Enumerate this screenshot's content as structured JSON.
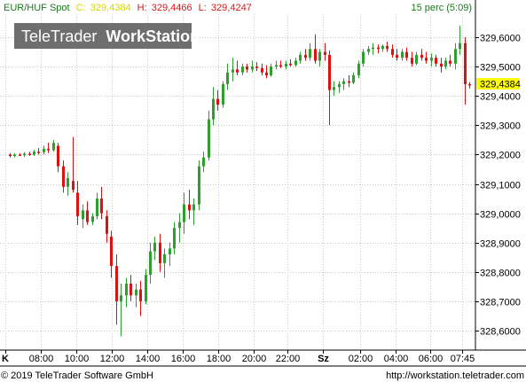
{
  "header": {
    "symbol": "EUR/HUF Spot",
    "close_label": "C:",
    "close_value": "329,4384",
    "high_label": "H:",
    "high_value": "329,4466",
    "low_label": "L:",
    "low_value": "329,4247",
    "interval": "15 perc (5:09)"
  },
  "watermark": {
    "text_normal": "TeleTrader",
    "text_bold": "WorkStation"
  },
  "last_price_tag": "329,4384",
  "footer": {
    "copyright": "© 2019 TeleTrader Software GmbH",
    "url": "http://workstation.teletrader.com"
  },
  "colors": {
    "up": "#2e9e2e",
    "down": "#dd1111",
    "grid": "#c8c8c8",
    "header_green": "#1a7a1a",
    "header_red": "#d81818",
    "close_yellow": "#d6d600",
    "tag_bg": "#ffff00",
    "watermark_bg": "#6e6e6e"
  },
  "chart_data": {
    "type": "candlestick",
    "title": "EUR/HUF Spot",
    "ylim": [
      328.54,
      329.66
    ],
    "y_ticks": [
      328.6,
      328.7,
      328.8,
      328.9,
      329.0,
      329.1,
      329.2,
      329.3,
      329.4,
      329.5,
      329.6
    ],
    "y_tick_labels": [
      "328,6000",
      "328,7000",
      "328,8000",
      "328,9000",
      "329,0000",
      "329,1000",
      "329,2000",
      "329,3000",
      "329,4000",
      "329,5000",
      "329,6000"
    ],
    "x_tick_labels": [
      "K",
      "08:00",
      "10:00",
      "12:00",
      "14:00",
      "16:00",
      "18:00",
      "20:00",
      "22:00",
      "Sz",
      "02:00",
      "04:00",
      "06:00",
      "07:45"
    ],
    "x_tick_bold": [
      true,
      false,
      false,
      false,
      false,
      false,
      false,
      false,
      false,
      true,
      false,
      false,
      false,
      false
    ],
    "grid": true,
    "candles": [
      {
        "o": 329.2,
        "h": 329.205,
        "l": 329.19,
        "c": 329.195
      },
      {
        "o": 329.195,
        "h": 329.205,
        "l": 329.19,
        "c": 329.2
      },
      {
        "o": 329.2,
        "h": 329.205,
        "l": 329.195,
        "c": 329.198
      },
      {
        "o": 329.198,
        "h": 329.208,
        "l": 329.192,
        "c": 329.203
      },
      {
        "o": 329.203,
        "h": 329.21,
        "l": 329.195,
        "c": 329.2
      },
      {
        "o": 329.2,
        "h": 329.215,
        "l": 329.195,
        "c": 329.21
      },
      {
        "o": 329.21,
        "h": 329.222,
        "l": 329.2,
        "c": 329.208
      },
      {
        "o": 329.208,
        "h": 329.23,
        "l": 329.2,
        "c": 329.22
      },
      {
        "o": 329.22,
        "h": 329.24,
        "l": 329.205,
        "c": 329.215
      },
      {
        "o": 329.215,
        "h": 329.25,
        "l": 329.21,
        "c": 329.24
      },
      {
        "o": 329.23,
        "h": 329.24,
        "l": 329.14,
        "c": 329.16
      },
      {
        "o": 329.16,
        "h": 329.18,
        "l": 329.07,
        "c": 329.09
      },
      {
        "o": 329.09,
        "h": 329.14,
        "l": 329.06,
        "c": 329.12
      },
      {
        "o": 329.11,
        "h": 329.26,
        "l": 329.07,
        "c": 329.08
      },
      {
        "o": 329.07,
        "h": 329.11,
        "l": 328.96,
        "c": 328.99
      },
      {
        "o": 328.98,
        "h": 329.03,
        "l": 328.95,
        "c": 329.01
      },
      {
        "o": 329.01,
        "h": 329.04,
        "l": 328.96,
        "c": 328.97
      },
      {
        "o": 328.97,
        "h": 329.0,
        "l": 328.96,
        "c": 328.99
      },
      {
        "o": 328.99,
        "h": 329.07,
        "l": 328.98,
        "c": 329.05
      },
      {
        "o": 329.05,
        "h": 329.09,
        "l": 328.98,
        "c": 329.0
      },
      {
        "o": 328.99,
        "h": 329.01,
        "l": 328.9,
        "c": 328.93
      },
      {
        "o": 328.92,
        "h": 328.94,
        "l": 328.78,
        "c": 328.82
      },
      {
        "o": 328.82,
        "h": 328.86,
        "l": 328.62,
        "c": 328.7
      },
      {
        "o": 328.7,
        "h": 328.76,
        "l": 328.58,
        "c": 328.72
      },
      {
        "o": 328.72,
        "h": 328.78,
        "l": 328.68,
        "c": 328.76
      },
      {
        "o": 328.76,
        "h": 328.79,
        "l": 328.7,
        "c": 328.72
      },
      {
        "o": 328.72,
        "h": 328.76,
        "l": 328.68,
        "c": 328.74
      },
      {
        "o": 328.74,
        "h": 328.77,
        "l": 328.65,
        "c": 328.7
      },
      {
        "o": 328.7,
        "h": 328.81,
        "l": 328.69,
        "c": 328.79
      },
      {
        "o": 328.79,
        "h": 328.9,
        "l": 328.76,
        "c": 328.87
      },
      {
        "o": 328.87,
        "h": 328.92,
        "l": 328.84,
        "c": 328.9
      },
      {
        "o": 328.9,
        "h": 328.93,
        "l": 328.8,
        "c": 328.83
      },
      {
        "o": 328.83,
        "h": 328.88,
        "l": 328.78,
        "c": 328.86
      },
      {
        "o": 328.86,
        "h": 328.9,
        "l": 328.82,
        "c": 328.88
      },
      {
        "o": 328.88,
        "h": 328.97,
        "l": 328.86,
        "c": 328.95
      },
      {
        "o": 328.95,
        "h": 329.0,
        "l": 328.9,
        "c": 328.97
      },
      {
        "o": 328.97,
        "h": 329.07,
        "l": 328.93,
        "c": 329.03
      },
      {
        "o": 329.03,
        "h": 329.08,
        "l": 328.98,
        "c": 329.01
      },
      {
        "o": 329.01,
        "h": 329.05,
        "l": 328.96,
        "c": 329.03
      },
      {
        "o": 329.03,
        "h": 329.18,
        "l": 329.01,
        "c": 329.16
      },
      {
        "o": 329.16,
        "h": 329.21,
        "l": 329.14,
        "c": 329.19
      },
      {
        "o": 329.19,
        "h": 329.35,
        "l": 329.18,
        "c": 329.32
      },
      {
        "o": 329.32,
        "h": 329.43,
        "l": 329.3,
        "c": 329.39
      },
      {
        "o": 329.39,
        "h": 329.42,
        "l": 329.35,
        "c": 329.37
      },
      {
        "o": 329.37,
        "h": 329.45,
        "l": 329.36,
        "c": 329.44
      },
      {
        "o": 329.44,
        "h": 329.51,
        "l": 329.42,
        "c": 329.48
      },
      {
        "o": 329.48,
        "h": 329.53,
        "l": 329.45,
        "c": 329.49
      },
      {
        "o": 329.49,
        "h": 329.52,
        "l": 329.47,
        "c": 329.48
      },
      {
        "o": 329.48,
        "h": 329.51,
        "l": 329.47,
        "c": 329.5
      },
      {
        "o": 329.5,
        "h": 329.51,
        "l": 329.48,
        "c": 329.49
      },
      {
        "o": 329.49,
        "h": 329.52,
        "l": 329.48,
        "c": 329.5
      },
      {
        "o": 329.5,
        "h": 329.515,
        "l": 329.485,
        "c": 329.495
      },
      {
        "o": 329.495,
        "h": 329.51,
        "l": 329.47,
        "c": 329.48
      },
      {
        "o": 329.48,
        "h": 329.505,
        "l": 329.46,
        "c": 329.47
      },
      {
        "o": 329.47,
        "h": 329.51,
        "l": 329.465,
        "c": 329.5
      },
      {
        "o": 329.5,
        "h": 329.52,
        "l": 329.49,
        "c": 329.505
      },
      {
        "o": 329.505,
        "h": 329.52,
        "l": 329.495,
        "c": 329.5
      },
      {
        "o": 329.5,
        "h": 329.52,
        "l": 329.49,
        "c": 329.51
      },
      {
        "o": 329.51,
        "h": 329.525,
        "l": 329.5,
        "c": 329.505
      },
      {
        "o": 329.505,
        "h": 329.53,
        "l": 329.5,
        "c": 329.52
      },
      {
        "o": 329.52,
        "h": 329.55,
        "l": 329.51,
        "c": 329.54
      },
      {
        "o": 329.54,
        "h": 329.56,
        "l": 329.52,
        "c": 329.53
      },
      {
        "o": 329.53,
        "h": 329.58,
        "l": 329.52,
        "c": 329.56
      },
      {
        "o": 329.56,
        "h": 329.61,
        "l": 329.51,
        "c": 329.52
      },
      {
        "o": 329.52,
        "h": 329.56,
        "l": 329.5,
        "c": 329.55
      },
      {
        "o": 329.55,
        "h": 329.58,
        "l": 329.52,
        "c": 329.54
      },
      {
        "o": 329.54,
        "h": 329.555,
        "l": 329.3,
        "c": 329.42
      },
      {
        "o": 329.42,
        "h": 329.45,
        "l": 329.4,
        "c": 329.43
      },
      {
        "o": 329.43,
        "h": 329.45,
        "l": 329.41,
        "c": 329.44
      },
      {
        "o": 329.44,
        "h": 329.46,
        "l": 329.42,
        "c": 329.45
      },
      {
        "o": 329.45,
        "h": 329.47,
        "l": 329.43,
        "c": 329.445
      },
      {
        "o": 329.445,
        "h": 329.48,
        "l": 329.44,
        "c": 329.47
      },
      {
        "o": 329.47,
        "h": 329.52,
        "l": 329.46,
        "c": 329.51
      },
      {
        "o": 329.51,
        "h": 329.56,
        "l": 329.5,
        "c": 329.55
      },
      {
        "o": 329.55,
        "h": 329.57,
        "l": 329.54,
        "c": 329.56
      },
      {
        "o": 329.56,
        "h": 329.58,
        "l": 329.54,
        "c": 329.565
      },
      {
        "o": 329.565,
        "h": 329.575,
        "l": 329.545,
        "c": 329.56
      },
      {
        "o": 329.56,
        "h": 329.575,
        "l": 329.55,
        "c": 329.57
      },
      {
        "o": 329.57,
        "h": 329.585,
        "l": 329.55,
        "c": 329.56
      },
      {
        "o": 329.56,
        "h": 329.575,
        "l": 329.53,
        "c": 329.54
      },
      {
        "o": 329.54,
        "h": 329.56,
        "l": 329.52,
        "c": 329.53
      },
      {
        "o": 329.53,
        "h": 329.56,
        "l": 329.52,
        "c": 329.55
      },
      {
        "o": 329.55,
        "h": 329.565,
        "l": 329.52,
        "c": 329.53
      },
      {
        "o": 329.53,
        "h": 329.55,
        "l": 329.5,
        "c": 329.51
      },
      {
        "o": 329.51,
        "h": 329.55,
        "l": 329.505,
        "c": 329.54
      },
      {
        "o": 329.54,
        "h": 329.56,
        "l": 329.52,
        "c": 329.53
      },
      {
        "o": 329.53,
        "h": 329.55,
        "l": 329.51,
        "c": 329.52
      },
      {
        "o": 329.52,
        "h": 329.545,
        "l": 329.5,
        "c": 329.53
      },
      {
        "o": 329.53,
        "h": 329.54,
        "l": 329.5,
        "c": 329.51
      },
      {
        "o": 329.51,
        "h": 329.53,
        "l": 329.48,
        "c": 329.5
      },
      {
        "o": 329.5,
        "h": 329.53,
        "l": 329.49,
        "c": 329.52
      },
      {
        "o": 329.52,
        "h": 329.54,
        "l": 329.5,
        "c": 329.51
      },
      {
        "o": 329.51,
        "h": 329.58,
        "l": 329.49,
        "c": 329.56
      },
      {
        "o": 329.56,
        "h": 329.64,
        "l": 329.54,
        "c": 329.58
      },
      {
        "o": 329.58,
        "h": 329.6,
        "l": 329.37,
        "c": 329.44
      },
      {
        "o": 329.44,
        "h": 329.447,
        "l": 329.425,
        "c": 329.438
      }
    ]
  }
}
